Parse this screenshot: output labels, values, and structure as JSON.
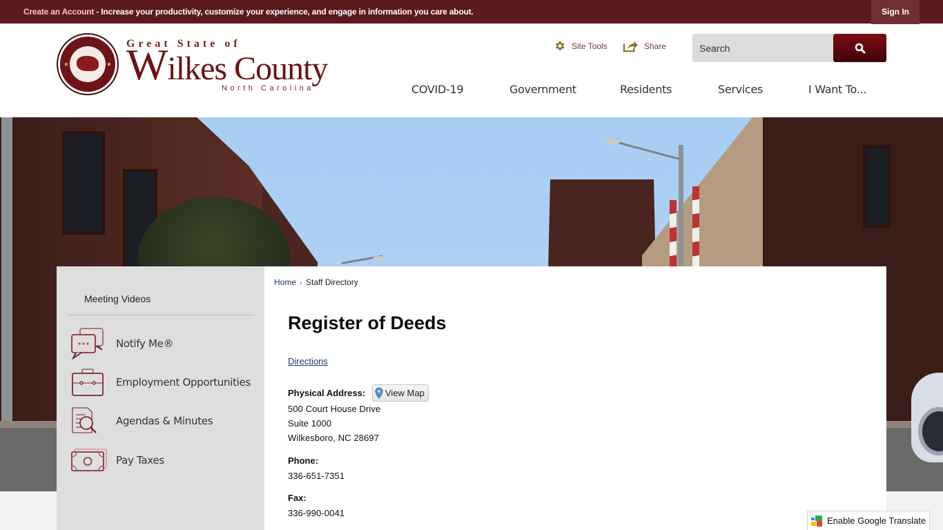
{
  "topbar": {
    "create_account_link": "Create an Account",
    "message": " - Increase your productivity, customize your experience, and engage in information you care about.",
    "sign_in": "Sign In"
  },
  "logo": {
    "line1": "Great State of",
    "big_initial": "W",
    "line2_rest": "ilkes County",
    "line3": "North Carolina"
  },
  "tools": {
    "site_tools": "Site Tools",
    "share": "Share"
  },
  "search": {
    "placeholder": "Search",
    "button_icon": "search-icon"
  },
  "nav": {
    "items": [
      "COVID-19",
      "Government",
      "Residents",
      "Services",
      "I Want To..."
    ]
  },
  "sidebar": {
    "link": "Meeting Videos",
    "quick_links": [
      {
        "label": "Notify Me®",
        "icon": "chat-bubbles-icon"
      },
      {
        "label": "Employment Opportunities",
        "icon": "briefcase-icon"
      },
      {
        "label": "Agendas & Minutes",
        "icon": "document-search-icon"
      },
      {
        "label": "Pay Taxes",
        "icon": "money-icon"
      }
    ]
  },
  "breadcrumb": {
    "home": "Home",
    "separator": "›",
    "current": "Staff Directory"
  },
  "department": {
    "title": "Register of Deeds",
    "directions_link": "Directions",
    "physical_address_label": "Physical Address:",
    "view_map_button": "View Map",
    "address_lines": [
      "500 Court House Drive",
      "Suite 1000",
      "Wilkesboro, NC 28697"
    ],
    "phone_label": "Phone:",
    "phone": "336-651-7351",
    "fax_label": "Fax:",
    "fax": "336-990-0041"
  },
  "translate": {
    "label": "Enable Google Translate"
  },
  "colors": {
    "brand_maroon": "#5b1a1e",
    "search_button": "#7d0c12",
    "icon_gold": "#8a6d1a",
    "link_blue": "#1f3b6b"
  }
}
